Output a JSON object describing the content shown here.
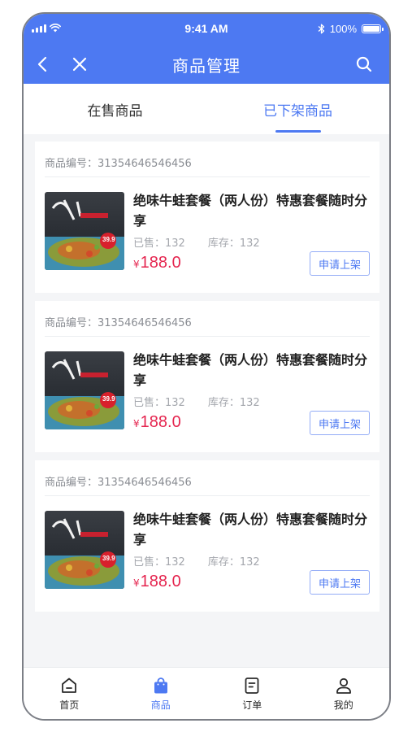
{
  "status_bar": {
    "time": "9:41 AM",
    "battery": "100%",
    "icons": [
      "signal-icon",
      "wifi-icon",
      "bluetooth-icon",
      "battery-icon"
    ]
  },
  "nav": {
    "title": "商品管理",
    "back_icon": "chevron-left-icon",
    "close_icon": "close-icon",
    "search_icon": "search-icon"
  },
  "tabs": [
    {
      "label": "在售商品",
      "active": false
    },
    {
      "label": "已下架商品",
      "active": true
    }
  ],
  "products": [
    {
      "id_label": "商品编号：31354646546456",
      "name": "绝味牛蛙套餐（两人份）特惠套餐随时分享",
      "sold": "已售：132",
      "stock": "库存：132",
      "currency": "¥",
      "price": "188.0",
      "action_label": "申请上架",
      "badge": "39.9"
    },
    {
      "id_label": "商品编号：31354646546456",
      "name": "绝味牛蛙套餐（两人份）特惠套餐随时分享",
      "sold": "已售：132",
      "stock": "库存：132",
      "currency": "¥",
      "price": "188.0",
      "action_label": "申请上架",
      "badge": "39.9"
    },
    {
      "id_label": "商品编号：31354646546456",
      "name": "绝味牛蛙套餐（两人份）特惠套餐随时分享",
      "sold": "已售：132",
      "stock": "库存：132",
      "currency": "¥",
      "price": "188.0",
      "action_label": "申请上架",
      "badge": "39.9"
    }
  ],
  "bottom_nav": [
    {
      "label": "首页",
      "icon": "home-icon",
      "active": false
    },
    {
      "label": "商品",
      "icon": "shopping-bag-icon",
      "active": true
    },
    {
      "label": "订单",
      "icon": "order-icon",
      "active": false
    },
    {
      "label": "我的",
      "icon": "user-icon",
      "active": false
    }
  ],
  "colors": {
    "primary": "#4d79f2",
    "price": "#e5254f",
    "background": "#f4f5f7"
  }
}
